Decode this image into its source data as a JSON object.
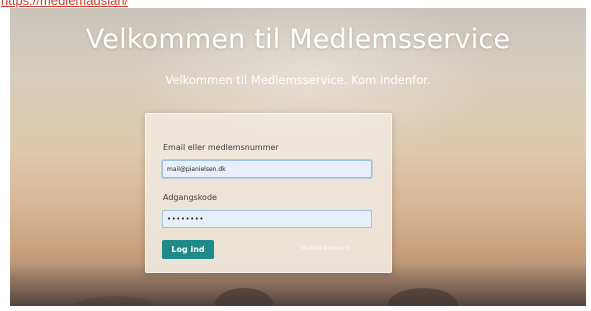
{
  "browser": {
    "url": "https://medlemadsian/"
  },
  "hero": {
    "title": "Velkommen til Medlemsservice",
    "subtitle": "Velkommen til Medlemsservice. Kom indenfor."
  },
  "login_form": {
    "email_label": "Email eller medlemsnummer",
    "email_value": "mail@pianielsen.dk",
    "password_label": "Adgangskode",
    "password_value": "••••••••",
    "login_button": "Log ind",
    "forgot_link": "Nulstil kodeord"
  },
  "colors": {
    "accent_button": "#1f8a8a",
    "url_text": "#d23b2c",
    "input_focus_border": "#9cc3e2"
  }
}
